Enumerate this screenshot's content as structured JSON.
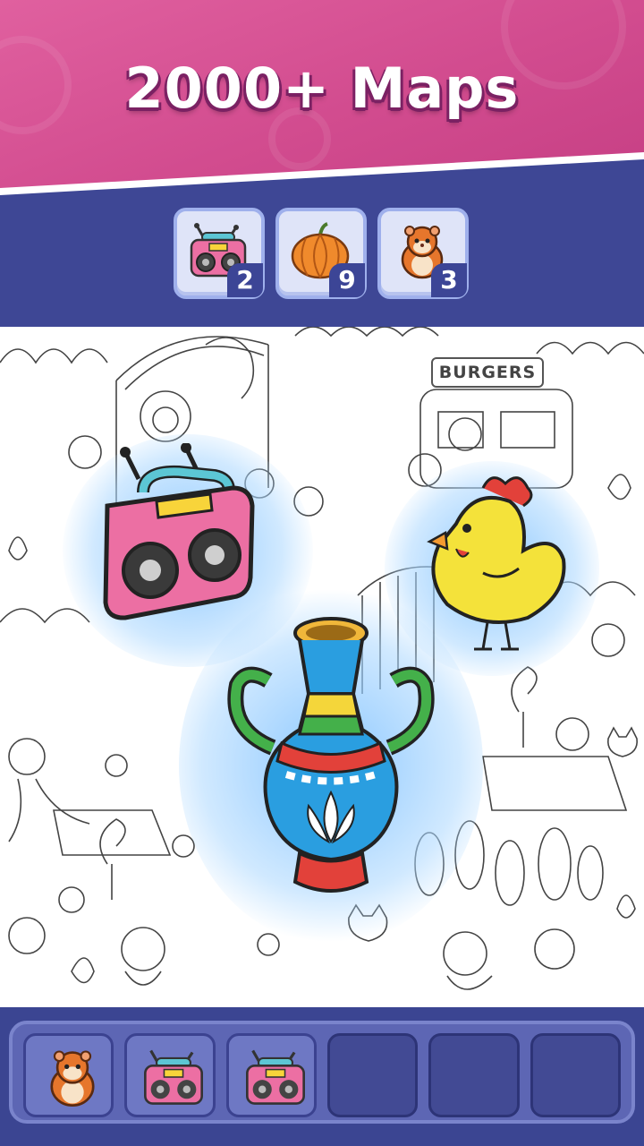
{
  "banner": {
    "title": "2000+ Maps"
  },
  "targets": [
    {
      "name": "radio-icon",
      "count": "2"
    },
    {
      "name": "pumpkin-icon",
      "count": "9"
    },
    {
      "name": "hamster-icon",
      "count": "3"
    }
  ],
  "map": {
    "sign_burgers": "BURGERS",
    "highlighted_items": [
      "radio-icon",
      "chicken-icon",
      "vase-icon"
    ]
  },
  "tray": {
    "slots": [
      {
        "item": "hamster-icon"
      },
      {
        "item": "radio-icon"
      },
      {
        "item": "radio-icon"
      },
      {
        "item": ""
      },
      {
        "item": ""
      },
      {
        "item": ""
      }
    ]
  },
  "colors": {
    "banner_pink": "#d24c8f",
    "strip_blue": "#3e4795",
    "tray_blue": "#5d66b4",
    "glow_blue": "#78beff"
  }
}
